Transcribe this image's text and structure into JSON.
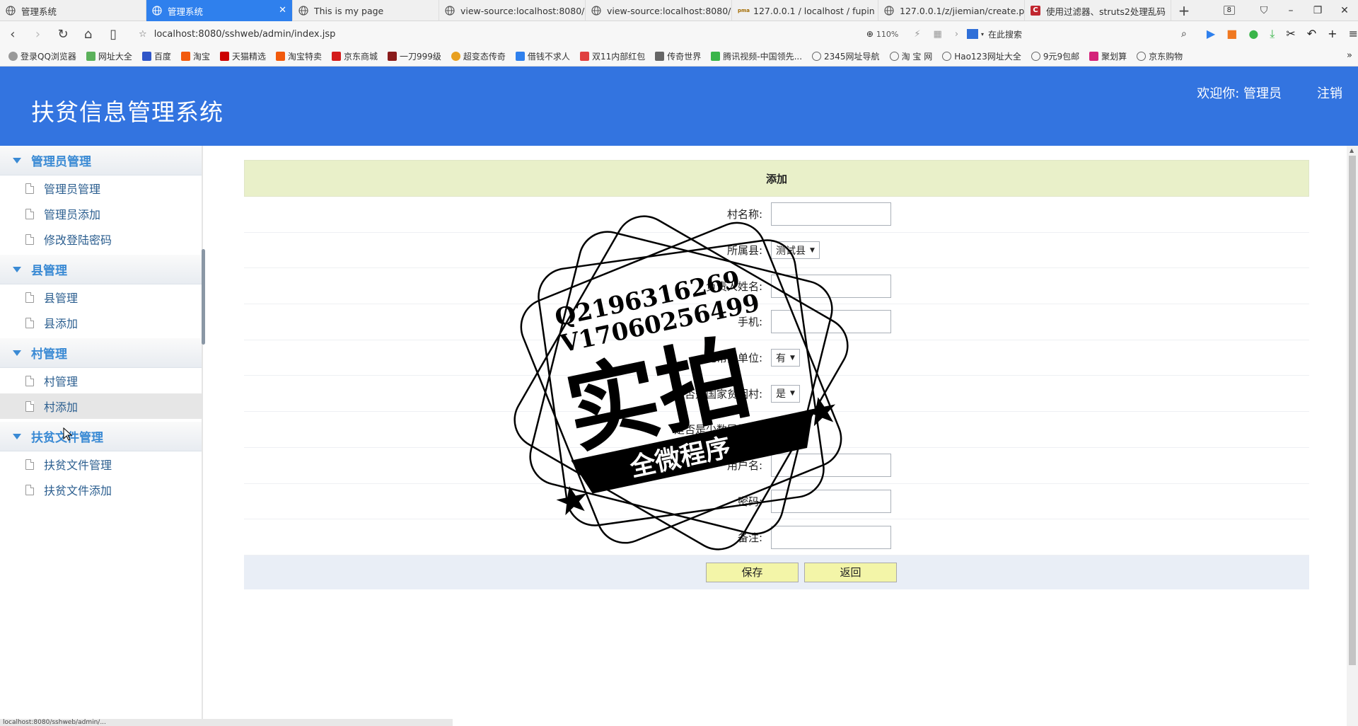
{
  "browser": {
    "tabs": [
      {
        "label": "管理系统",
        "active": false
      },
      {
        "label": "管理系统",
        "active": true
      },
      {
        "label": "This is my page",
        "active": false
      },
      {
        "label": "view-source:localhost:8080/",
        "active": false
      },
      {
        "label": "view-source:localhost:8080/",
        "active": false
      },
      {
        "label": "127.0.0.1 / localhost / fupin",
        "active": false
      },
      {
        "label": "127.0.0.1/z/jiemian/create.p",
        "active": false
      },
      {
        "label": "使用过滤器、struts2处理乱码",
        "active": false
      }
    ],
    "tab_count": "8",
    "url": "localhost:8080/sshweb/admin/index.jsp",
    "zoom": "110%",
    "search_placeholder": "在此搜索",
    "bookmarks": [
      "登录QQ浏览器",
      "网址大全",
      "百度",
      "淘宝",
      "天猫精选",
      "淘宝特卖",
      "京东商城",
      "一刀999级",
      "超变态传奇",
      "借钱不求人",
      "双11内部红包",
      "传奇世界",
      "腾讯视频-中国领先...",
      "2345网址导航",
      "淘 宝 网",
      "Hao123网址大全",
      "9元9包邮",
      "聚划算",
      "京东购物"
    ],
    "status_text": "localhost:8080/sshweb/admin/..."
  },
  "header": {
    "title": "扶贫信息管理系统",
    "welcome": "欢迎你: 管理员",
    "logout": "注销"
  },
  "sidebar": {
    "groups": [
      {
        "title": "管理员管理",
        "items": [
          "管理员管理",
          "管理员添加",
          "修改登陆密码"
        ]
      },
      {
        "title": "县管理",
        "items": [
          "县管理",
          "县添加"
        ]
      },
      {
        "title": "村管理",
        "items": [
          "村管理",
          "村添加"
        ]
      },
      {
        "title": "扶贫文件管理",
        "items": [
          "扶贫文件管理",
          "扶贫文件添加"
        ]
      }
    ]
  },
  "form": {
    "title": "添加",
    "fields": [
      {
        "label": "村名称:",
        "type": "text",
        "value": ""
      },
      {
        "label": "所属县:",
        "type": "select",
        "value": "测试县"
      },
      {
        "label": "负责人姓名:",
        "type": "text",
        "value": ""
      },
      {
        "label": "手机:",
        "type": "text",
        "value": ""
      },
      {
        "label": "无帮扶单位:",
        "type": "select",
        "value": "有"
      },
      {
        "label": "是否是国家贫困村:",
        "type": "select",
        "value": "是"
      },
      {
        "label": "是否是少数民族村:",
        "type": "select",
        "value": "是"
      },
      {
        "label": "用户名:",
        "type": "text",
        "value": ""
      },
      {
        "label": "密码:",
        "type": "text",
        "value": ""
      },
      {
        "label": "备注:",
        "type": "text",
        "value": ""
      }
    ],
    "save_label": "保存",
    "back_label": "返回"
  },
  "watermark": {
    "line1": "Q2196316269",
    "line2": "V17060256499",
    "big": "实拍",
    "ribbon": "全微程序"
  }
}
